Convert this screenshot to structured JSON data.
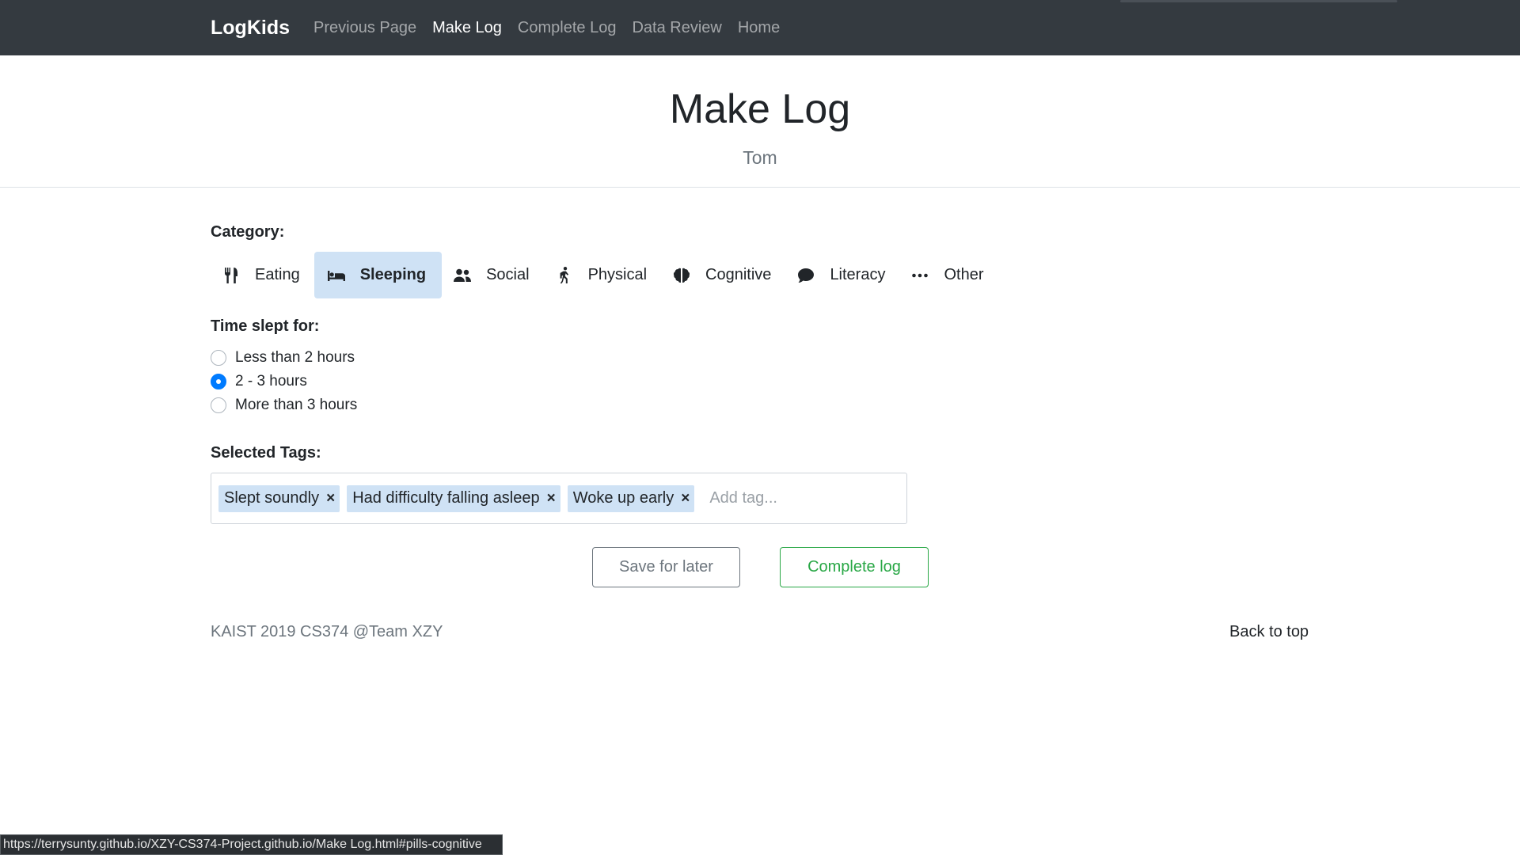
{
  "navbar": {
    "brand": "LogKids",
    "links": [
      {
        "label": "Previous Page",
        "active": false
      },
      {
        "label": "Make Log",
        "active": true
      },
      {
        "label": "Complete Log",
        "active": false
      },
      {
        "label": "Data Review",
        "active": false
      },
      {
        "label": "Home",
        "active": false
      }
    ]
  },
  "header": {
    "title": "Make Log",
    "subtitle": "Tom"
  },
  "category": {
    "label": "Category:",
    "items": [
      {
        "label": "Eating",
        "icon": "utensils-icon",
        "active": false
      },
      {
        "label": "Sleeping",
        "icon": "bed-icon",
        "active": true
      },
      {
        "label": "Social",
        "icon": "users-icon",
        "active": false
      },
      {
        "label": "Physical",
        "icon": "walking-icon",
        "active": false
      },
      {
        "label": "Cognitive",
        "icon": "brain-icon",
        "active": false
      },
      {
        "label": "Literacy",
        "icon": "comment-icon",
        "active": false
      },
      {
        "label": "Other",
        "icon": "ellipsis-icon",
        "active": false
      }
    ]
  },
  "time_slept": {
    "label": "Time slept for:",
    "options": [
      {
        "label": "Less than 2 hours",
        "checked": false
      },
      {
        "label": "2 - 3 hours",
        "checked": true
      },
      {
        "label": "More than 3 hours",
        "checked": false
      }
    ]
  },
  "tags": {
    "label": "Selected Tags:",
    "selected": [
      "Slept soundly",
      "Had difficulty falling asleep",
      "Woke up early"
    ],
    "remove_glyph": "×",
    "placeholder": "Add tag..."
  },
  "buttons": {
    "save_label": "Save for later",
    "complete_label": "Complete log"
  },
  "footer": {
    "text": "KAIST 2019 CS374 @Team XZY",
    "back_to_top": "Back to top"
  },
  "status_bar": {
    "url": "https://terrysunty.github.io/XZY-CS374-Project.github.io/Make Log.html#pills-cognitive"
  },
  "colors": {
    "navbar_bg": "#343a40",
    "active_pill_bg": "#cfe2f5",
    "tag_bg": "#cfe2f5",
    "radio_checked": "#007bff",
    "complete_button": "#28a745",
    "save_button": "#6c757d"
  }
}
